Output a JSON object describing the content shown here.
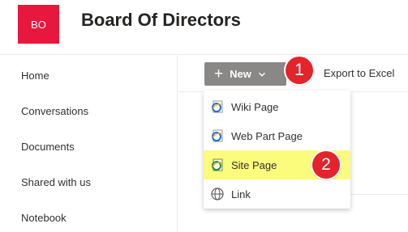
{
  "header": {
    "logo_text": "BO",
    "logo_color": "#e8173d",
    "site_title": "Board Of Directors"
  },
  "sidebar": {
    "items": [
      {
        "label": "Home"
      },
      {
        "label": "Conversations"
      },
      {
        "label": "Documents"
      },
      {
        "label": "Shared with us"
      },
      {
        "label": "Notebook"
      }
    ]
  },
  "toolbar": {
    "new_label": "New",
    "new_icon": "plus-icon",
    "new_chevron_icon": "chevron-down-icon",
    "export_label": "Export to Excel",
    "export_icon": "excel-icon"
  },
  "new_menu": {
    "items": [
      {
        "label": "Wiki Page",
        "icon": "ie-page-icon",
        "highlighted": false
      },
      {
        "label": "Web Part Page",
        "icon": "ie-page-icon",
        "highlighted": false
      },
      {
        "label": "Site Page",
        "icon": "ie-green-page-icon",
        "highlighted": true
      },
      {
        "label": "Link",
        "icon": "globe-icon",
        "highlighted": false
      }
    ],
    "highlight_color": "#fbfb7c"
  },
  "annotations": {
    "callout_1": "1",
    "callout_2": "2",
    "callout_color": "#e3242b"
  }
}
